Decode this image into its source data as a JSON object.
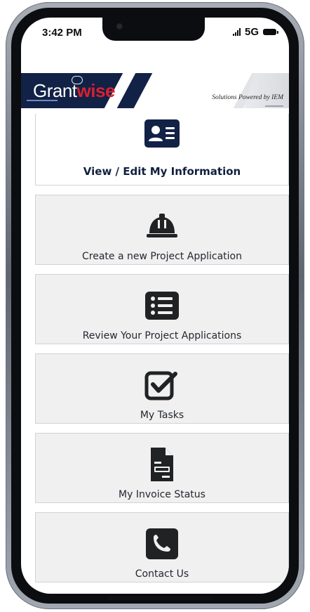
{
  "status_bar": {
    "time": "3:42 PM",
    "network": "5G"
  },
  "header": {
    "logo_grant": "Grant",
    "logo_wise": "wise",
    "tagline": "Solutions Powered by IEM"
  },
  "menu": {
    "items": [
      {
        "label": "View / Edit My Information",
        "icon": "contact-card-icon"
      },
      {
        "label": "Create a new Project Application",
        "icon": "hard-hat-icon"
      },
      {
        "label": "Review Your Project Applications",
        "icon": "list-icon"
      },
      {
        "label": "My Tasks",
        "icon": "checkbox-icon"
      },
      {
        "label": "My Invoice Status",
        "icon": "invoice-icon"
      },
      {
        "label": "Contact Us",
        "icon": "phone-icon"
      }
    ]
  },
  "colors": {
    "navy": "#122146",
    "red": "#d82030",
    "card_bg": "#f0f0f0",
    "card_border": "#cfd3d8",
    "text": "#23272f",
    "icon": "#202224"
  }
}
